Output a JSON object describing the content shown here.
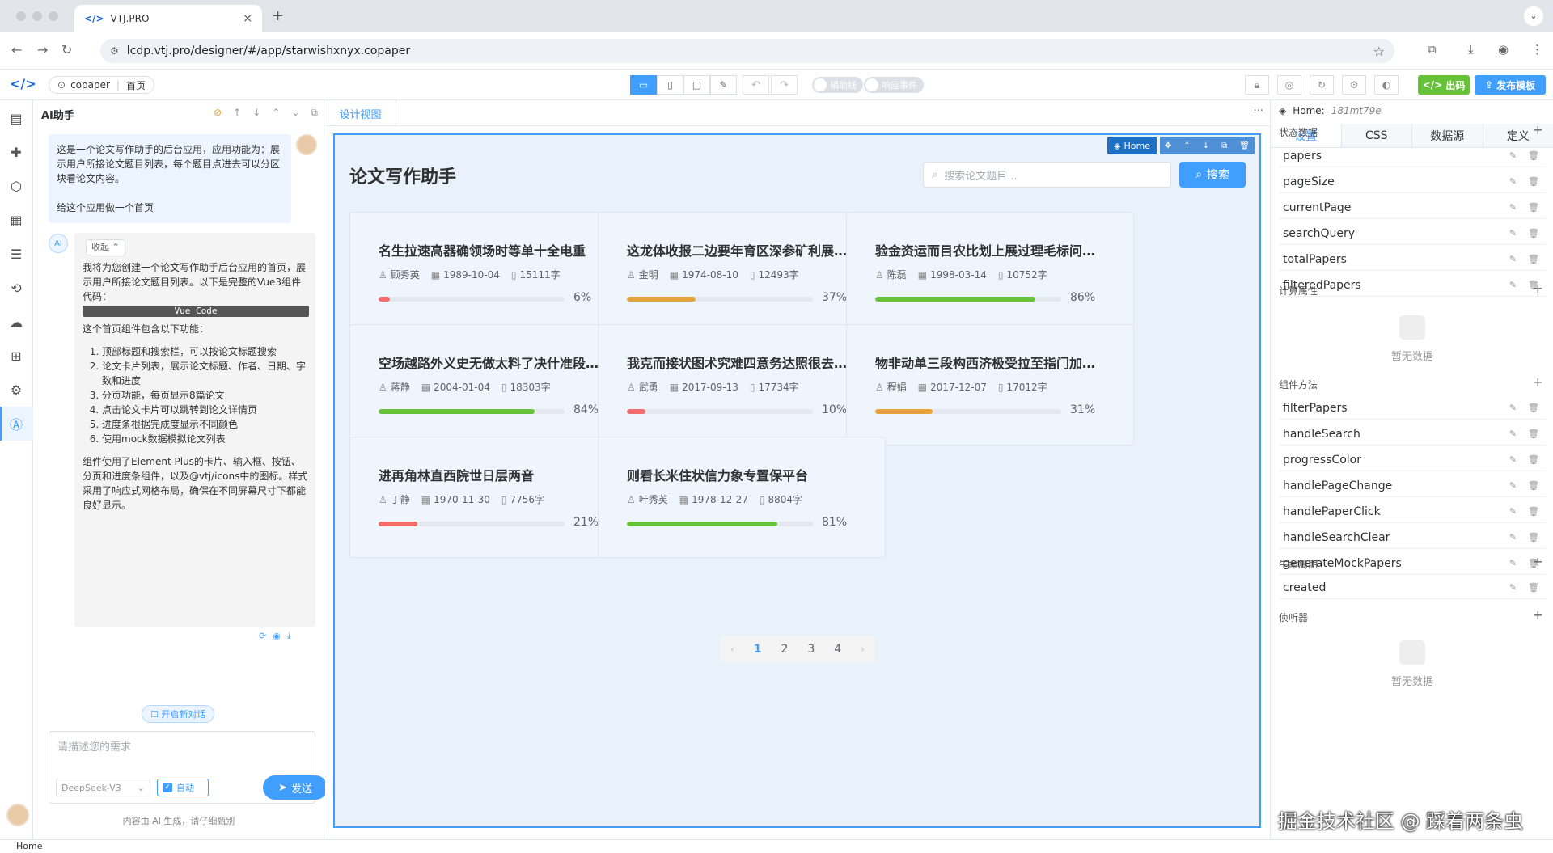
{
  "browser": {
    "tab_title": "VTJ.PRO",
    "url": "lcdp.vtj.pro/designer/#/app/starwishxnyx.copaper"
  },
  "app": {
    "crumb_app": "copaper",
    "crumb_page": "首页",
    "toggle_aux": "辅助线",
    "toggle_events": "响应事件",
    "btn_code": "出码",
    "btn_publish": "发布模板"
  },
  "ai": {
    "title": "AI助手",
    "user_msg_1": "这是一个论文写作助手的后台应用，应用功能为：展示用户所接论文题目列表，每个题目点进去可以分区块看论文内容。",
    "user_msg_2": "给这个应用做一个首页",
    "collapse_label": "收起",
    "ai_intro": "我将为您创建一个论文写作助手后台应用的首页，展示用户所接论文题目列表。以下是完整的Vue3组件代码：",
    "code_label": "Vue Code",
    "features_intro": "这个首页组件包含以下功能：",
    "features": [
      "顶部标题和搜索栏，可以按论文标题搜索",
      "论文卡片列表，展示论文标题、作者、日期、字数和进度",
      "分页功能，每页显示8篇论文",
      "点击论文卡片可以跳转到论文详情页",
      "进度条根据完成度显示不同颜色",
      "使用mock数据模拟论文列表"
    ],
    "ai_outro": "组件使用了Element Plus的卡片、输入框、按钮、分页和进度条组件，以及@vtj/icons中的图标。样式采用了响应式网格布局，确保在不同屏幕尺寸下都能良好显示。",
    "new_chat": "开启新对话",
    "input_placeholder": "请描述您的需求",
    "model": "DeepSeek-V3",
    "auto_label": "自动",
    "send_label": "发送",
    "footer": "内容由 AI 生成，请仔细甄别"
  },
  "center": {
    "tab_label": "设计视图",
    "sel_label": "Home",
    "page_title": "论文写作助手",
    "search_placeholder": "搜索论文题目...",
    "search_btn": "搜索",
    "cards": [
      {
        "title": "名生拉速高器确领场时等单十全电重",
        "author": "顾秀英",
        "date": "1989-10-04",
        "words": "15111字",
        "progress": 6,
        "progress_text": "6%",
        "color": "#f56c6c"
      },
      {
        "title": "这龙体收报二边要年育区深参矿利展…",
        "author": "金明",
        "date": "1974-08-10",
        "words": "12493字",
        "progress": 37,
        "progress_text": "37%",
        "color": "#e6a23c"
      },
      {
        "title": "验金资运而目农比划上展过理毛标问…",
        "author": "陈磊",
        "date": "1998-03-14",
        "words": "10752字",
        "progress": 86,
        "progress_text": "86%",
        "color": "#67c23a"
      },
      {
        "title": "空场越路外义史无做太料了决什准段…",
        "author": "蒋静",
        "date": "2004-01-04",
        "words": "18303字",
        "progress": 84,
        "progress_text": "84%",
        "color": "#67c23a"
      },
      {
        "title": "我克而接状图术究难四意务达照很去…",
        "author": "武勇",
        "date": "2017-09-13",
        "words": "17734字",
        "progress": 10,
        "progress_text": "10%",
        "color": "#f56c6c"
      },
      {
        "title": "物非动单三段构西济极受拉至指门加…",
        "author": "程娟",
        "date": "2017-12-07",
        "words": "17012字",
        "progress": 31,
        "progress_text": "31%",
        "color": "#e6a23c"
      },
      {
        "title": "进再角林直西院世日层两音",
        "author": "丁静",
        "date": "1970-11-30",
        "words": "7756字",
        "progress": 21,
        "progress_text": "21%",
        "color": "#f56c6c"
      },
      {
        "title": "则看长米住状信力象专置保平台",
        "author": "叶秀英",
        "date": "1978-12-27",
        "words": "8804字",
        "progress": 81,
        "progress_text": "81%",
        "color": "#67c23a"
      }
    ],
    "pages": [
      "1",
      "2",
      "3",
      "4"
    ],
    "current_page": "1"
  },
  "right": {
    "head_label": "Home:",
    "head_id": "181mt79e",
    "tabs": [
      "设置",
      "CSS",
      "数据源",
      "定义"
    ],
    "sec_state": "状态数据",
    "state_items": [
      "papers",
      "pageSize",
      "currentPage",
      "searchQuery",
      "totalPapers",
      "filteredPapers"
    ],
    "sec_computed": "计算属性",
    "empty": "暂无数据",
    "sec_methods": "组件方法",
    "methods": [
      "filterPapers",
      "handleSearch",
      "progressColor",
      "handlePageChange",
      "handlePaperClick",
      "handleSearchClear",
      "generateMockPapers"
    ],
    "sec_lifecycle": "生命周期",
    "lifecycle": [
      "created"
    ],
    "sec_listener": "侦听器"
  },
  "status": {
    "text": "Home"
  },
  "watermark": "掘金技术社区 @ 踩着两条虫"
}
